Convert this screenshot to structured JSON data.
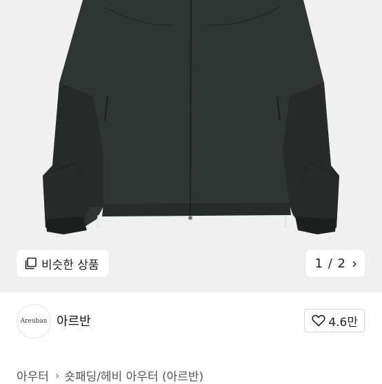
{
  "product_image": {
    "alt_icon": "jacket-photo"
  },
  "similar_products": {
    "icon": "similar-items-icon",
    "label": "비슷한 상품"
  },
  "pager": {
    "text": "1 / 2",
    "icon": "chevron-right-icon"
  },
  "seller": {
    "avatar_text": "Areuban",
    "name": "아르반"
  },
  "like": {
    "icon": "heart-icon",
    "count": "4.6만"
  },
  "breadcrumb": {
    "items": [
      "아우터",
      "숏패딩/헤비 아우터 (아르반)"
    ],
    "separator_icon": "chevron-right-icon"
  },
  "colors": {
    "photo_bg": "#f0f0f0",
    "jacket": "#2f3532"
  }
}
